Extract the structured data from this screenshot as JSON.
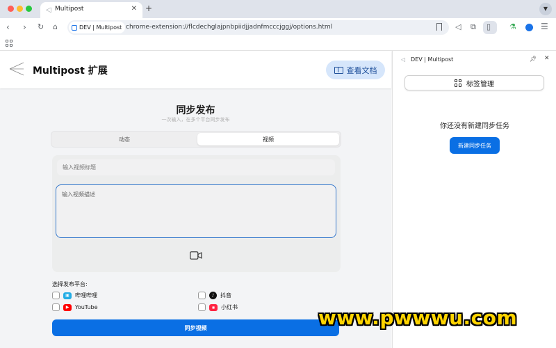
{
  "browser": {
    "tab_title": "Multipost",
    "new_tab_symbol": "+",
    "site_chip": "DEV | Multipost",
    "url": "chrome-extension://flcdechglajpnbpiidjjadnfmcccjggj/options.html"
  },
  "header": {
    "app_title": "Multipost 扩展",
    "docs_button": "查看文档"
  },
  "publish": {
    "title": "同步发布",
    "subtitle": "一次输入，在多个平台同步发布",
    "tabs": [
      {
        "label": "动态",
        "active": false
      },
      {
        "label": "视频",
        "active": true
      }
    ],
    "title_placeholder": "输入视频标题",
    "description_placeholder": "输入视频描述",
    "platform_label": "选择发布平台:",
    "platforms": [
      {
        "name": "哔哩哔哩",
        "color": "#23ade5",
        "checked": false
      },
      {
        "name": "抖音",
        "color": "#111111",
        "checked": false
      },
      {
        "name": "YouTube",
        "color": "#ff0000",
        "checked": false
      },
      {
        "name": "小红书",
        "color": "#ff2442",
        "checked": false
      }
    ],
    "submit_button": "同步视频"
  },
  "side_panel": {
    "title": "DEV | Multipost",
    "tag_button": "标签管理",
    "empty_text": "你还没有新建同步任务",
    "new_task_button": "新建同步任务"
  },
  "watermark": "www.pwwwu.com",
  "colors": {
    "accent": "#0a6fe4",
    "docs_bg": "#d6e6fb"
  }
}
